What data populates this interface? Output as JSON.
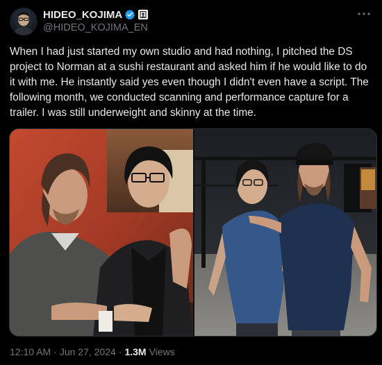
{
  "author": {
    "display_name": "HIDEO_KOJIMA",
    "handle": "@HIDEO_KOJIMA_EN",
    "verified_icon": "verified-badge-icon",
    "affiliate_icon": "affiliate-badge-icon",
    "avatar_icon": "avatar"
  },
  "tweet": {
    "text": "When I had just started my own studio and had nothing, I pitched the DS project to Norman at a sushi restaurant and asked him if he would like to do it with me. He instantly said yes even though I didn't even have a script. The following month, we conducted scanning and performance capture for a trailer. I was still underweight and skinny at the time."
  },
  "meta": {
    "time": "12:10 AM",
    "date": "Jun 27, 2024",
    "separator": "·",
    "views_count": "1.3M",
    "views_label": "Views"
  },
  "colors": {
    "background": "#000000",
    "text": "#e7e9ea",
    "secondary_text": "#71767b",
    "verified_blue": "#1d9bf0"
  }
}
